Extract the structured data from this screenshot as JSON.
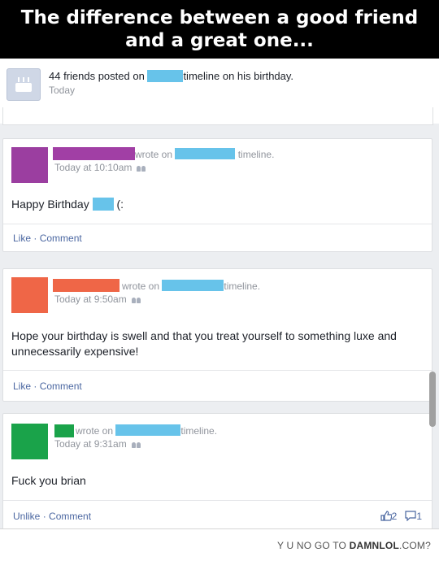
{
  "banner": {
    "line1": "The difference between a good friend",
    "line2": "and a great one..."
  },
  "notification": {
    "icon": "birthday-cake-icon",
    "text_before": "44 friends posted on",
    "text_after": "timeline on his birthday.",
    "time": "Today"
  },
  "posts": [
    {
      "avatar_color": "#9b3ea0",
      "name_color": "#a13fa5",
      "wrote_on": "wrote on",
      "timeline": "timeline.",
      "time": "Today at 10:10am",
      "message_before": "Happy Birthday",
      "message_after": "(:",
      "like": "Like",
      "sep": "·",
      "comment": "Comment"
    },
    {
      "avatar_color": "#ef6647",
      "name_color": "#ef6647",
      "wrote_on": "wrote on",
      "timeline": "timeline.",
      "time": "Today at 9:50am",
      "message": "Hope your birthday is swell and that you treat yourself to something luxe and unnecessarily expensive!",
      "like": "Like",
      "sep": "·",
      "comment": "Comment"
    },
    {
      "avatar_color": "#1aa34a",
      "name_color": "#1aa34a",
      "wrote_on": "wrote on",
      "timeline": "timeline.",
      "time": "Today at 9:31am",
      "message": "Fuck you brian",
      "like": "Unlike",
      "sep": "·",
      "comment": "Comment",
      "likes_count": "2",
      "comments_count": "1"
    }
  ],
  "redaction_color": "#67c3ea",
  "footer": {
    "prefix": "Y U NO GO TO ",
    "site": "DAMNLOL",
    "suffix": ".COM?"
  }
}
